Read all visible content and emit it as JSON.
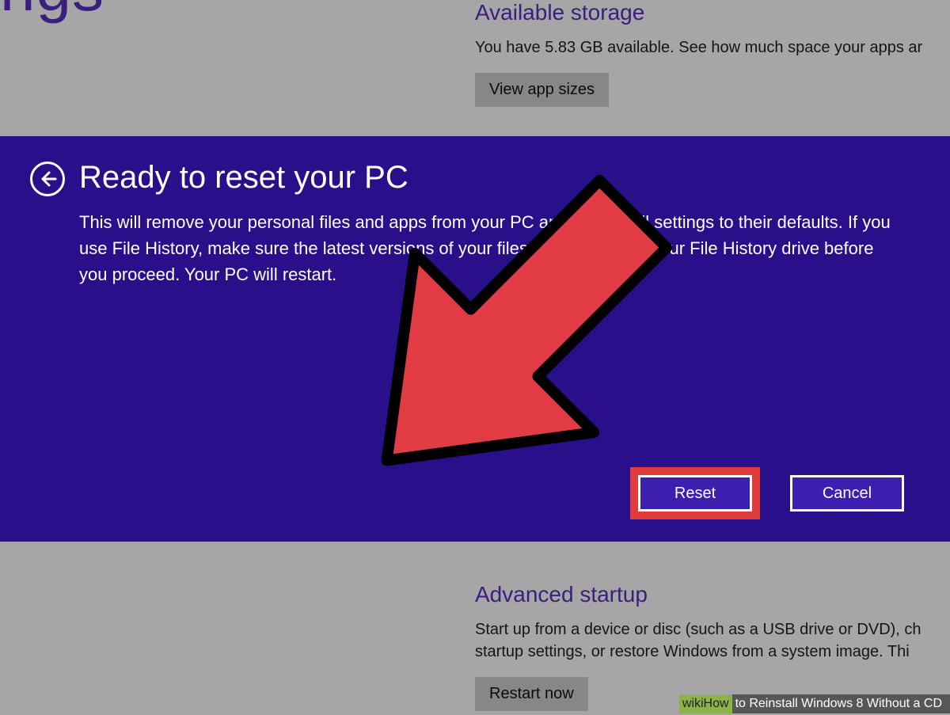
{
  "background": {
    "leftTitle": "ngs",
    "availableStorage": {
      "title": "Available storage",
      "text": "You have 5.83 GB available. See how much space your apps ar",
      "button": "View app sizes"
    },
    "advancedStartup": {
      "title": "Advanced startup",
      "text": "Start up from a device or disc (such as a USB drive or DVD), ch startup settings, or restore Windows from a system image. Thi",
      "button": "Restart now"
    }
  },
  "modal": {
    "title": "Ready to reset your PC",
    "body": "This will remove your personal files and apps from your PC and restore all settings to their defaults. If you use File History, make sure the latest versions of your files were copied to your File History drive before you proceed. Your PC will restart.",
    "resetLabel": "Reset",
    "cancelLabel": "Cancel"
  },
  "caption": {
    "brand": "wikiHow",
    "text": " to Reinstall Windows 8 Without a CD"
  }
}
